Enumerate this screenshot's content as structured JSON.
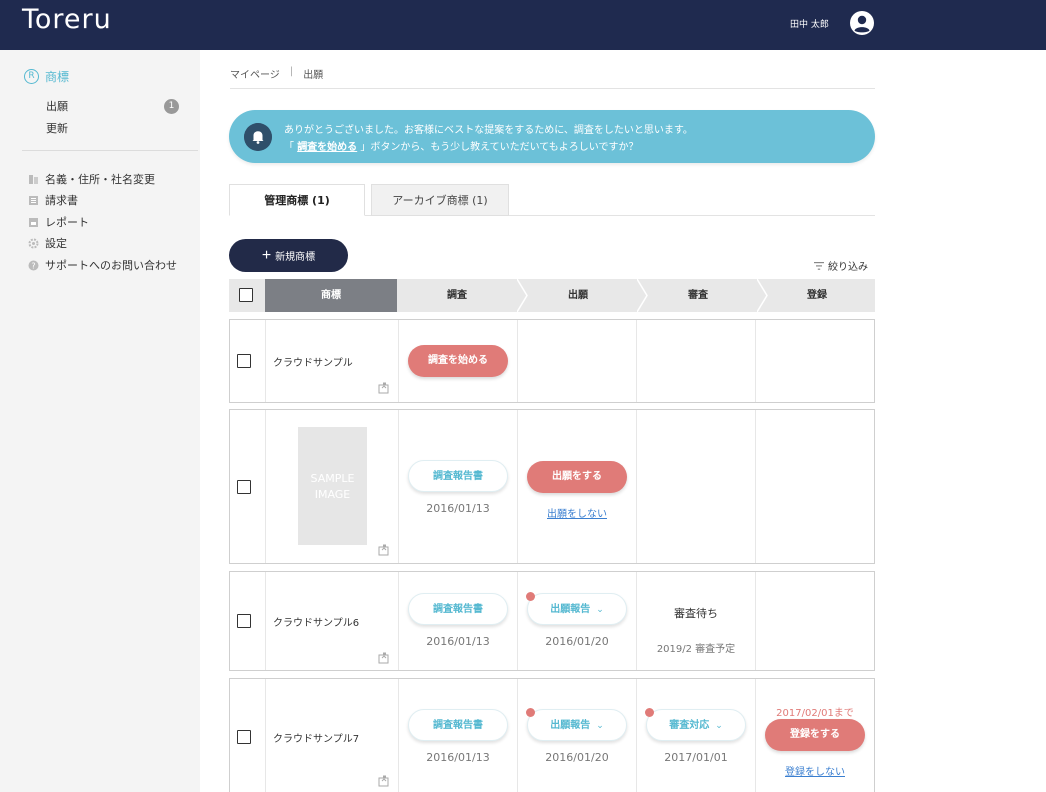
{
  "header": {
    "logo": "Toreru",
    "user_name": "田中 太郎"
  },
  "sidebar": {
    "section_icon": "R",
    "section_title": "商標",
    "sub_items": [
      {
        "label": "出願",
        "badge": "1"
      },
      {
        "label": "更新"
      }
    ],
    "items": [
      {
        "label": "名義・住所・社名変更",
        "icon": "document-icon"
      },
      {
        "label": "請求書",
        "icon": "invoice-icon"
      },
      {
        "label": "レポート",
        "icon": "report-icon"
      },
      {
        "label": "設定",
        "icon": "gear-icon"
      },
      {
        "label": "サポートへのお問い合わせ",
        "icon": "help-icon"
      }
    ]
  },
  "breadcrumb": {
    "items": [
      "マイページ",
      "出願"
    ],
    "separator": "|"
  },
  "notice": {
    "line1": "ありがとうございました。お客様にベストな提案をするために、調査をしたいと思います。",
    "line2_prefix": "「",
    "line2_link": "調査を始める",
    "line2_suffix": "」ボタンから、もう少し教えていただいてもよろしいですか？"
  },
  "tabs": [
    {
      "label": "管理商標 (1)",
      "active": true
    },
    {
      "label": "アーカイブ商標 (1)",
      "active": false
    }
  ],
  "toolbar": {
    "new_button": "新規商標",
    "filter": "絞り込み"
  },
  "table": {
    "columns": [
      "商標",
      "調査",
      "出願",
      "審査",
      "登録"
    ],
    "rows": [
      {
        "name": "クラウドサンプル",
        "survey_button": "調査を始める"
      },
      {
        "image_text_1": "SAMPLE",
        "image_text_2": "IMAGE",
        "survey_button": "調査報告書",
        "survey_date": "2016/01/13",
        "filing_button": "出願をする",
        "filing_link": "出願をしない"
      },
      {
        "name": "クラウドサンプル6",
        "survey_button": "調査報告書",
        "survey_date": "2016/01/13",
        "filing_button": "出願報告",
        "filing_date": "2016/01/20",
        "exam_status": "審査待ち",
        "exam_sub": "2019/2 審査予定"
      },
      {
        "name": "クラウドサンプル7",
        "survey_button": "調査報告書",
        "survey_date": "2016/01/13",
        "filing_button": "出願報告",
        "filing_date": "2016/01/20",
        "exam_button": "審査対応",
        "exam_date": "2017/01/01",
        "reg_deadline": "2017/02/01まで",
        "reg_button": "登録をする",
        "reg_link": "登録をしない"
      }
    ]
  },
  "colors": {
    "header_bg": "#1f2a4f",
    "accent": "#56b9d1",
    "notice_bg": "#6cc1d8",
    "primary_button": "#e07b78",
    "new_button": "#222a48"
  }
}
